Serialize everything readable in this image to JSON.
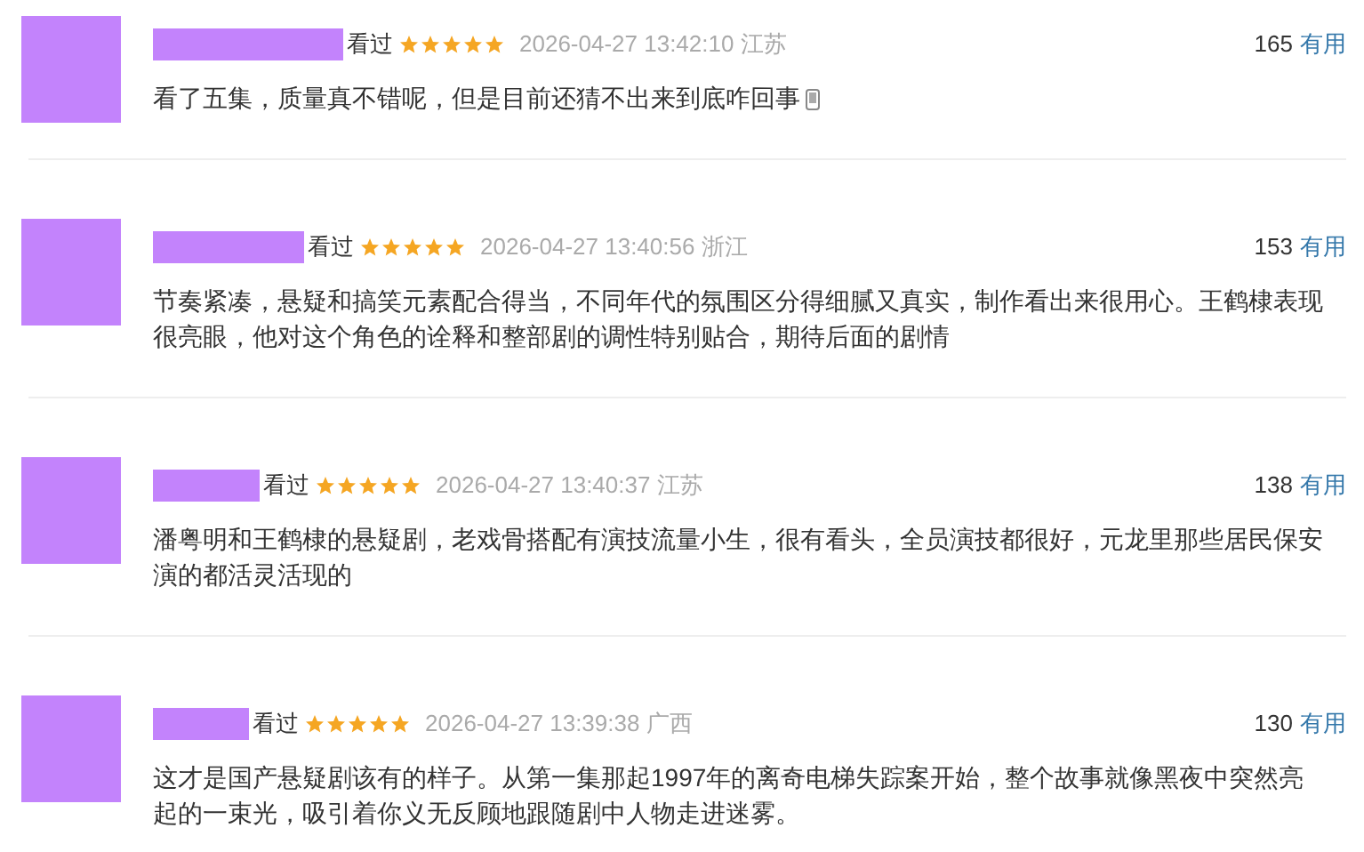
{
  "reviews": [
    {
      "watched": "看过",
      "stars": 5,
      "time": "2026-04-27 13:42:10",
      "location": "江苏",
      "useful_count": "165",
      "useful_label": "有用",
      "text": "看了五集，质量真不错呢，但是目前还猜不出来到底咋回事",
      "trailing_icon": true
    },
    {
      "watched": "看过",
      "stars": 5,
      "time": "2026-04-27 13:40:56",
      "location": "浙江",
      "useful_count": "153",
      "useful_label": "有用",
      "text": "节奏紧凑，悬疑和搞笑元素配合得当，不同年代的氛围区分得细腻又真实，制作看出来很用心。王鹤棣表现很亮眼，他对这个角色的诠释和整部剧的调性特别贴合，期待后面的剧情",
      "trailing_icon": false
    },
    {
      "watched": "看过",
      "stars": 5,
      "time": "2026-04-27 13:40:37",
      "location": "江苏",
      "useful_count": "138",
      "useful_label": "有用",
      "text": "潘粤明和王鹤棣的悬疑剧，老戏骨搭配有演技流量小生，很有看头，全员演技都很好，元龙里那些居民保安演的都活灵活现的",
      "trailing_icon": false
    },
    {
      "watched": "看过",
      "stars": 5,
      "time": "2026-04-27 13:39:38",
      "location": "广西",
      "useful_count": "130",
      "useful_label": "有用",
      "text": "这才是国产悬疑剧该有的样子。从第一集那起1997年的离奇电梯失踪案开始，整个故事就像黑夜中突然亮起的一束光，吸引着你义无反顾地跟随剧中人物走进迷雾。",
      "trailing_icon": false
    }
  ]
}
